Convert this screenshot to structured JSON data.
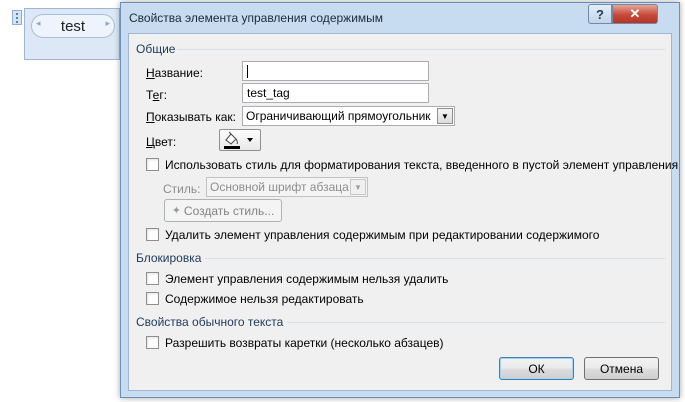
{
  "document": {
    "control_text": "test"
  },
  "dialog": {
    "title": "Свойства элемента управления содержимым",
    "help_button": "?",
    "close_button": "✕"
  },
  "general": {
    "section_title": "Общие",
    "name_label": "Название:",
    "name_value": "",
    "tag_label": "Тег:",
    "tag_value": "test_tag",
    "show_as_label": "Показывать как:",
    "show_as_value": "Ограничивающий прямоугольник",
    "color_label": "Цвет:",
    "use_style_label": "Использовать стиль для форматирования текста, введенного в пустой элемент управления",
    "use_style_checked": false,
    "style_label": "Стиль:",
    "style_value": "Основной шрифт абзаца",
    "create_style_button": "Создать стиль...",
    "remove_on_edit_label": "Удалить элемент управления содержимым при редактировании содержимого",
    "remove_on_edit_checked": false
  },
  "locking": {
    "section_title": "Блокировка",
    "cannot_delete_label": "Элемент управления содержимым нельзя удалить",
    "cannot_delete_checked": false,
    "cannot_edit_label": "Содержимое нельзя редактировать",
    "cannot_edit_checked": false
  },
  "plain_text": {
    "section_title": "Свойства обычного текста",
    "allow_returns_label": "Разрешить возвраты каретки (несколько абзацев)",
    "allow_returns_checked": false
  },
  "buttons": {
    "ok": "ОК",
    "cancel": "Отмена"
  },
  "colors": {
    "dialog_frame": "#c7dcf0",
    "dialog_body": "#f0f0f0",
    "section_title": "#1e395b",
    "close_button": "#c5493a"
  }
}
